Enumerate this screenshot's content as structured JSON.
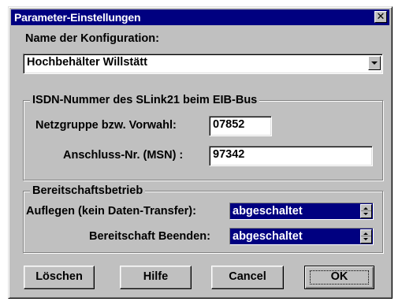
{
  "dialog": {
    "title": "Parameter-Einstellungen",
    "close_glyph": "✕"
  },
  "config": {
    "label": "Name der Konfiguration:",
    "value": "Hochbehälter Willstätt"
  },
  "isdn": {
    "group_title": "ISDN-Nummer des SLink21 beim EIB-Bus",
    "netzgruppe_label": "Netzgruppe bzw. Vorwahl:",
    "netzgruppe_value": "07852",
    "msn_label": "Anschluss-Nr. (MSN) :",
    "msn_value": "97342"
  },
  "standby": {
    "group_title": "Bereitschaftsbetrieb",
    "auflegen_label": "Auflegen (kein Daten-Transfer):",
    "auflegen_value": "abgeschaltet",
    "beenden_label": "Bereitschaft Beenden:",
    "beenden_value": "abgeschaltet"
  },
  "buttons": {
    "loeschen": "Löschen",
    "hilfe": "Hilfe",
    "cancel": "Cancel",
    "ok": "OK"
  },
  "colors": {
    "face": "#c0c0c0",
    "titlebar": "#000080",
    "selection": "#000080"
  }
}
